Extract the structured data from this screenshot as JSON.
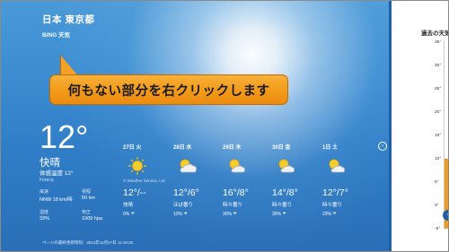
{
  "location": {
    "name": "日本 東京都",
    "source": "BING 天気"
  },
  "callout": {
    "text": "何もない部分を右クリックします"
  },
  "current": {
    "temp": "12°",
    "condition": "快晴",
    "feels_like": "体感温度 12°",
    "provider": "Foreca",
    "details": [
      {
        "label": "風速",
        "value": "NNW 18 km/時"
      },
      {
        "label": "視程",
        "value": "50 km"
      },
      {
        "label": "湿度",
        "value": "33%"
      },
      {
        "label": "気圧",
        "value": "1009 hpa"
      }
    ]
  },
  "forecast": [
    {
      "day": "27日 火",
      "icon": "sun-icon",
      "temp": "12°/--",
      "cond": "快晴",
      "precip": "0% ☂"
    },
    {
      "day": "28日 水",
      "icon": "cloud-sun-icon",
      "temp": "12°/6°",
      "cond": "ほぼ曇り",
      "precip": "10% ☂"
    },
    {
      "day": "29日 木",
      "icon": "cloud-sun-icon",
      "temp": "16°/8°",
      "cond": "時々曇り",
      "precip": "30% ☂"
    },
    {
      "day": "30日 金",
      "icon": "cloud-sun-icon",
      "temp": "14°/8°",
      "cond": "時々曇り",
      "precip": "30% ☂"
    },
    {
      "day": "1日 土",
      "icon": "cloud-sun-icon",
      "temp": "12°/7°",
      "cond": "時々曇り",
      "precip": "20% ☂"
    }
  ],
  "copyright": "© Weather Service, Ltd",
  "updated": "ページの最終更新時刻：2012年11月27日 11:19:26",
  "history": {
    "title": "過去の天気",
    "ticks": [
      "35°",
      "30°",
      "25°",
      "20°",
      "15°",
      "10°",
      "5°",
      "0°",
      "-5°"
    ],
    "bar_top_value": 10
  },
  "colors": {
    "accent": "#f29a1a",
    "sky": "#2f7dc6",
    "panel_border": "#1f5fa6"
  }
}
